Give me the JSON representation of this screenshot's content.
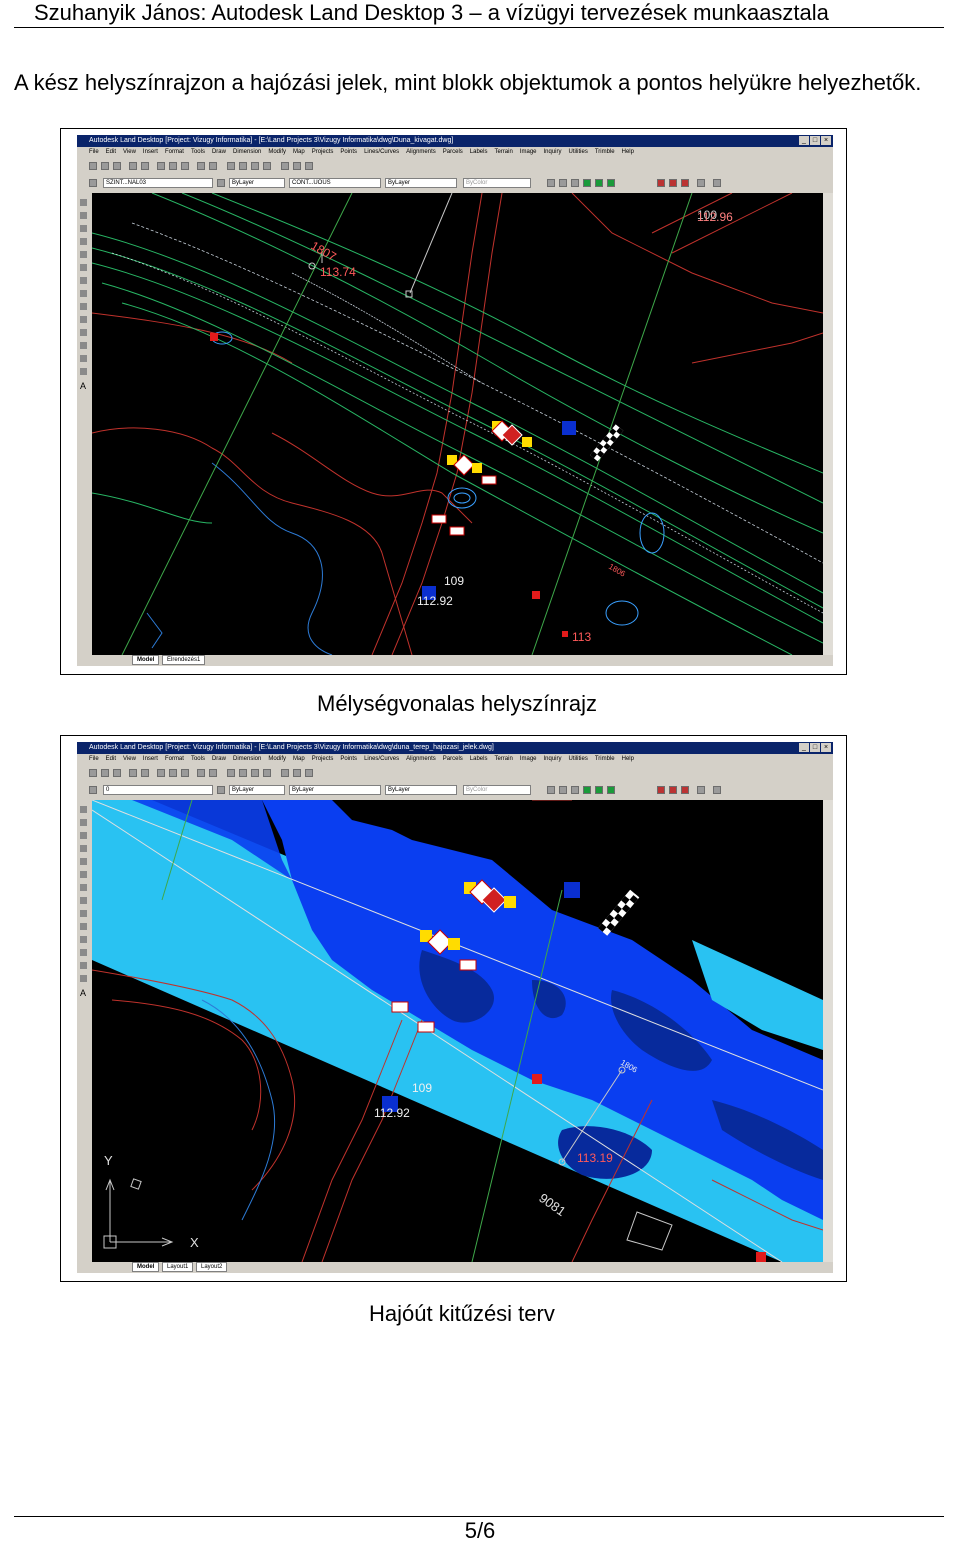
{
  "header": {
    "text": "Szuhanyik János: Autodesk Land Desktop 3 – a vízügyi tervezések munkaasztala"
  },
  "intro": {
    "text": "A kész helyszínrajzon a hajózási jelek, mint blokk objektumok a pontos helyükre helyezhetők."
  },
  "figures": [
    {
      "window_title": "Autodesk Land Desktop [Project: Vizugy Informatika] - [E:\\Land Projects 3\\Vizugy Informatika\\dwg\\Duna_kivagat.dwg]",
      "menu": [
        "File",
        "Edit",
        "View",
        "Insert",
        "Format",
        "Tools",
        "Draw",
        "Dimension",
        "Modify",
        "Map",
        "Projects",
        "Points",
        "Lines/Curves",
        "Alignments",
        "Parcels",
        "Labels",
        "Terrain",
        "Image",
        "Inquiry",
        "Utilities",
        "Trimble",
        "Help"
      ],
      "layer_combo": "SZINT...NAL03",
      "color_combo": "ByLayer",
      "linetype_combo": "CONT...UOUS",
      "lineweight_combo": "ByLayer",
      "plotstyle_combo": "ByColor",
      "tabs": [
        "Model",
        "Elrendezés1"
      ],
      "labels": {
        "l1807": "1807",
        "l11374": "113.74",
        "l109": "109",
        "l11292": "112.92",
        "l100": "100",
        "l11296": "112.96",
        "l1806": "1806",
        "l113": "113"
      },
      "caption": "Mélységvonalas helyszínrajz"
    },
    {
      "window_title": "Autodesk Land Desktop [Project: Vizugy Informatika] - [E:\\Land Projects 3\\Vizugy Informatika\\dwg\\duna_terep_hajozasi_jelek.dwg]",
      "menu": [
        "File",
        "Edit",
        "View",
        "Insert",
        "Format",
        "Tools",
        "Draw",
        "Dimension",
        "Modify",
        "Map",
        "Projects",
        "Points",
        "Lines/Curves",
        "Alignments",
        "Parcels",
        "Labels",
        "Terrain",
        "Image",
        "Inquiry",
        "Utilities",
        "Trimble",
        "Help"
      ],
      "layer_combo": "0",
      "color_combo": "ByLayer",
      "linetype_combo": "ByLayer",
      "lineweight_combo": "ByLayer",
      "plotstyle_combo": "ByColor",
      "tabs": [
        "Model",
        "Layout1",
        "Layout2"
      ],
      "labels": {
        "l109": "109",
        "l11292": "112.92",
        "l1806": "1806",
        "l11319": "113.19",
        "l9081": "9081",
        "axis_y": "Y",
        "axis_x": "X"
      },
      "caption": "Hajóút kitűzési terv"
    }
  ],
  "footer": {
    "page": "5/6"
  },
  "colors": {
    "title_bar": "#0a246a",
    "river_light": "#29c2f2",
    "river_mid": "#0a3ef0",
    "river_dark": "#072a9c",
    "contour_green": "#2bbf6a",
    "alignment_red": "#c0322c"
  }
}
